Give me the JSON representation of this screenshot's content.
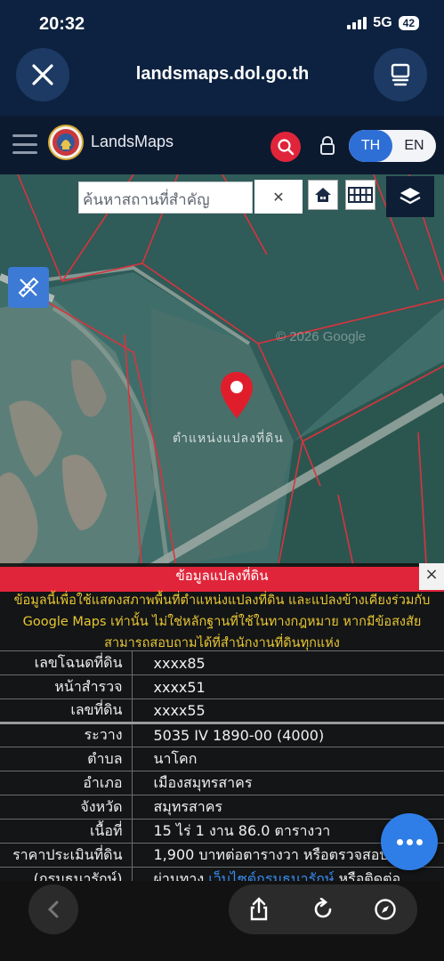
{
  "status": {
    "time": "20:32",
    "network": "5G",
    "battery": "42"
  },
  "browser": {
    "url": "landsmaps.dol.go.th",
    "close_icon": "close-icon",
    "tabs_icon": "tabs-icon"
  },
  "header": {
    "brand": "LandsMaps",
    "lang_th": "TH",
    "lang_en": "EN"
  },
  "map": {
    "search_placeholder": "ค้นหาสถานที่สำคัญ",
    "clear": "✕",
    "watermark": "© 2026 Google",
    "parcel_label": "ตำแหน่งแปลงที่ดิน"
  },
  "panel": {
    "title": "ข้อมูลแปลงที่ดิน",
    "close": "×",
    "notice": "ข้อมูลนี้เพื่อใช้แสดงสภาพพื้นที่ตำแหน่งแปลงที่ดิน และแปลงข้างเคียงร่วมกับ Google Maps เท่านั้น ไม่ใช่หลักฐานที่ใช้ในทางกฎหมาย หากมีข้อสงสัยสามารถสอบถามได้ที่สำนักงานที่ดินทุกแห่ง",
    "rows": [
      {
        "label": "เลขโฉนดที่ดิน",
        "value": "xxxx85"
      },
      {
        "label": "หน้าสำรวจ",
        "value": "xxxx51"
      },
      {
        "label": "เลขที่ดิน",
        "value": "xxxx55"
      },
      {
        "label": "ระวาง",
        "value": "5035 IV 1890-00 (4000)"
      },
      {
        "label": "ตำบล",
        "value": "นาโคก"
      },
      {
        "label": "อำเภอ",
        "value": "เมืองสมุทรสาคร"
      },
      {
        "label": "จังหวัด",
        "value": "สมุทรสาคร"
      },
      {
        "label": "เนื้อที่",
        "value": "15 ไร่ 1 งาน 86.0 ตารางวา"
      },
      {
        "label": "ราคาประเมินที่ดิน",
        "value": "1,900 บาทต่อตารางวา หรือตรวจสอบได้ที่"
      },
      {
        "label": "(กรมธนารักษ์)",
        "value_pre": "ผ่านทาง ",
        "value_link": "เว็บไซต์กรมธนารักษ์",
        "value_post": " หรือติดต่อ"
      }
    ]
  }
}
